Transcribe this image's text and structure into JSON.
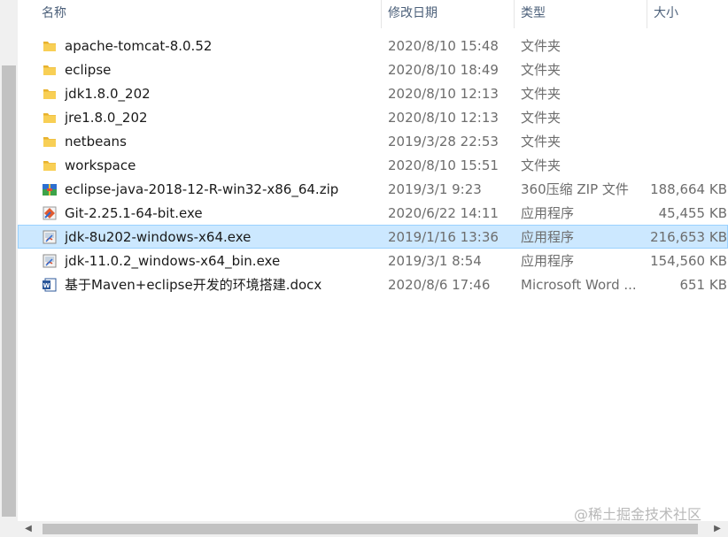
{
  "columns": {
    "name": "名称",
    "date": "修改日期",
    "type": "类型",
    "size": "大小"
  },
  "files": [
    {
      "icon": "folder-icon",
      "name": "apache-tomcat-8.0.52",
      "date": "2020/8/10 15:48",
      "type": "文件夹",
      "size": ""
    },
    {
      "icon": "folder-icon",
      "name": "eclipse",
      "date": "2020/8/10 18:49",
      "type": "文件夹",
      "size": ""
    },
    {
      "icon": "folder-icon",
      "name": "jdk1.8.0_202",
      "date": "2020/8/10 12:13",
      "type": "文件夹",
      "size": ""
    },
    {
      "icon": "folder-icon",
      "name": "jre1.8.0_202",
      "date": "2020/8/10 12:13",
      "type": "文件夹",
      "size": ""
    },
    {
      "icon": "folder-icon",
      "name": "netbeans",
      "date": "2019/3/28 22:53",
      "type": "文件夹",
      "size": ""
    },
    {
      "icon": "folder-icon",
      "name": "workspace",
      "date": "2020/8/10 15:51",
      "type": "文件夹",
      "size": ""
    },
    {
      "icon": "zip-archive-icon",
      "name": "eclipse-java-2018-12-R-win32-x86_64.zip",
      "date": "2019/3/1 9:23",
      "type": "360压缩 ZIP 文件",
      "size": "188,664 KB"
    },
    {
      "icon": "git-installer-icon",
      "name": "Git-2.25.1-64-bit.exe",
      "date": "2020/6/22 14:11",
      "type": "应用程序",
      "size": "45,455 KB"
    },
    {
      "icon": "java-installer-icon",
      "name": "jdk-8u202-windows-x64.exe",
      "date": "2019/1/16 13:36",
      "type": "应用程序",
      "size": "216,653 KB",
      "selected": true
    },
    {
      "icon": "java-installer-icon",
      "name": "jdk-11.0.2_windows-x64_bin.exe",
      "date": "2019/3/1 8:54",
      "type": "应用程序",
      "size": "154,560 KB"
    },
    {
      "icon": "word-document-icon",
      "name": "基于Maven+eclipse开发的环境搭建.docx",
      "date": "2020/8/6 17:46",
      "type": "Microsoft Word ...",
      "size": "651 KB"
    }
  ],
  "watermark": "@稀土掘金技术社区",
  "colors": {
    "selection_bg": "#cce8ff",
    "selection_border": "#99d1ff",
    "folder": "#f5c542",
    "header_text": "#4c607a"
  }
}
